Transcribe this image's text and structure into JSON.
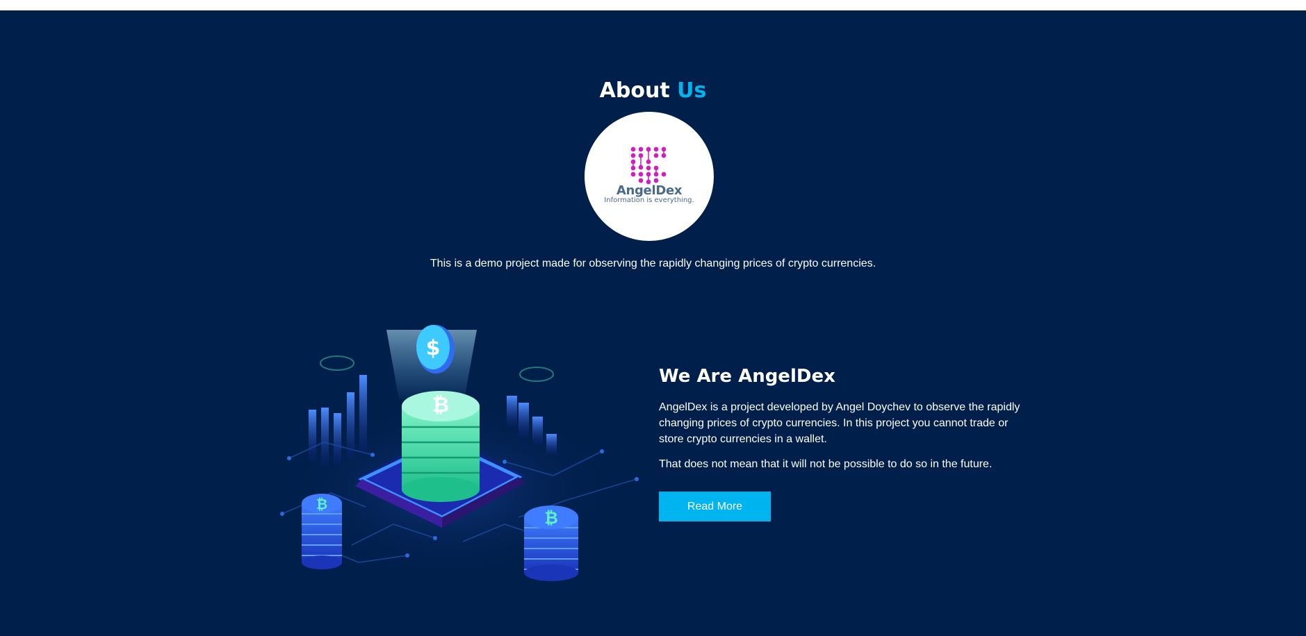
{
  "about": {
    "title_main": "About",
    "title_accent": "Us",
    "intro_text": "This is a demo project made for observing the rapidly changing prices of crypto currencies."
  },
  "logo": {
    "name": "AngelDex",
    "tagline": "Information is everything."
  },
  "content": {
    "heading": "We Are AngelDex",
    "paragraph1": "AngelDex is a project developed by Angel Doychev to observe the rapidly changing prices of crypto currencies. In this project you cannot trade or store crypto currencies in a wallet.",
    "paragraph2": "That does not mean that it will not be possible to do so in the future.",
    "button_label": "Read More"
  },
  "illustration": {
    "icon": "crypto-coins-illustration"
  },
  "colors": {
    "background": "#011f4b",
    "accent": "#00b4ef",
    "text": "#ffffff",
    "logo_magenta": "#d01fc0",
    "logo_text": "#4a6a8c"
  }
}
